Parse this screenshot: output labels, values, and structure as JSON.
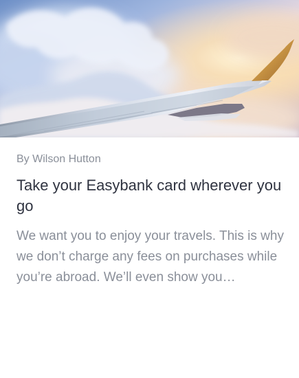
{
  "article": {
    "image": {
      "icon": "airplane-wing-above-clouds-image",
      "colors": {
        "sky_top": "#7b9ccf",
        "sun": "#f7d7a4",
        "wing": "#d9dfec",
        "winglet": "#c8923d"
      }
    },
    "author": "By Wilson Hutton",
    "title": "Take your Easybank card wherever you go",
    "excerpt": "We want you to enjoy your travels. This is why we don’t charge any fees on purchases while you’re abroad. We’ll even show you…"
  },
  "theme": {
    "card_background": "#ffffff",
    "title_color": "#2f3340",
    "body_color": "#8a8f99"
  }
}
